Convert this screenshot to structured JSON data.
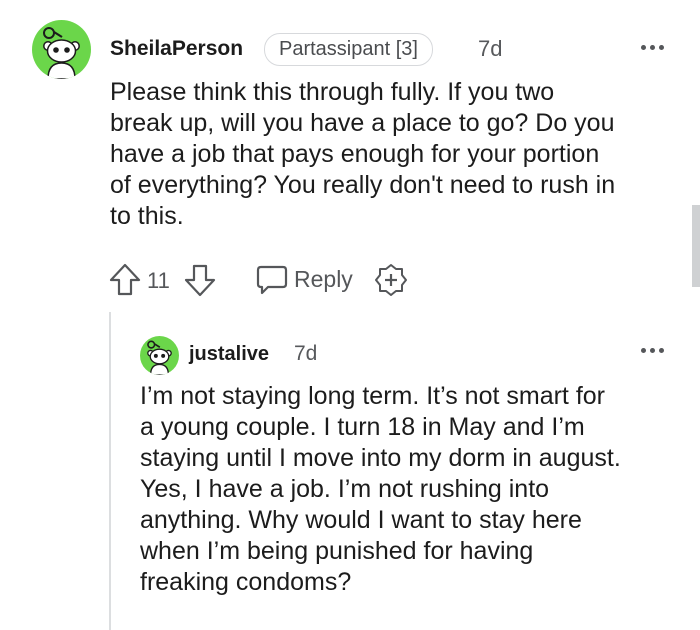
{
  "comment": {
    "avatar_icon": "snoo-avatar-icon",
    "username": "SheilaPerson",
    "flair": "Partassipant [3]",
    "timestamp": "7d",
    "text": "Please think this through fully. If you two\nbreak up, will you have a place to go? Do you\nhave a job that pays enough for your portion\nof everything? You really don't need to rush in\nto this.",
    "vote_count": "11",
    "reply_label": "Reply",
    "icons": {
      "upvote": "arrow-up-icon",
      "downvote": "arrow-down-icon",
      "reply": "speech-bubble-icon",
      "award": "plus-badge-icon",
      "more": "more-dots-icon"
    }
  },
  "reply": {
    "avatar_icon": "snoo-avatar-icon",
    "username": "justalive",
    "timestamp": "7d",
    "text": "I’m not staying long term. It’s not smart for\na young couple. I turn 18 in May and I’m\nstaying until I move into my dorm in august.\nYes, I have a job. I’m not rushing into\nanything. Why would I want to stay here\nwhen I’m being punished for having\nfreaking condoms?"
  },
  "colors": {
    "avatar_green": "#6bd64a",
    "text": "#1c1c1c",
    "muted": "#55575a",
    "flair_border": "#d7d9dc",
    "thread_line": "#dcdee0"
  }
}
